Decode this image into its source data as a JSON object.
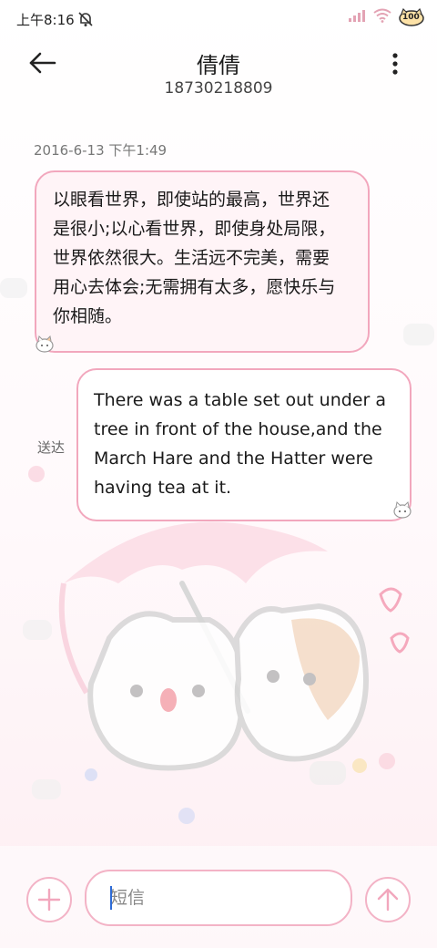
{
  "status_bar": {
    "time": "上午8:16",
    "battery_label": "100"
  },
  "header": {
    "contact_name": "倩倩",
    "phone_number": "18730218809"
  },
  "conversation": {
    "timestamp": "2016-6-13 下午1:49",
    "incoming": {
      "lines": [
        "以眼看世界，即使站的最高，世界还",
        "是很小;以心看世界，即使身处局限，",
        "世界依然很大。生活远不完美，需要",
        "用心去体会;无需拥有太多，愿快乐与",
        "你相随。"
      ]
    },
    "outgoing": {
      "lines": [
        "There was a table set out under a",
        "tree in front of the house,and the",
        "March Hare and the Hatter were",
        "having tea at it."
      ],
      "status": "送达"
    }
  },
  "composer": {
    "placeholder": "短信"
  },
  "colors": {
    "accent_pink": "#f2a7bd",
    "caret_blue": "#2d6bd6"
  }
}
